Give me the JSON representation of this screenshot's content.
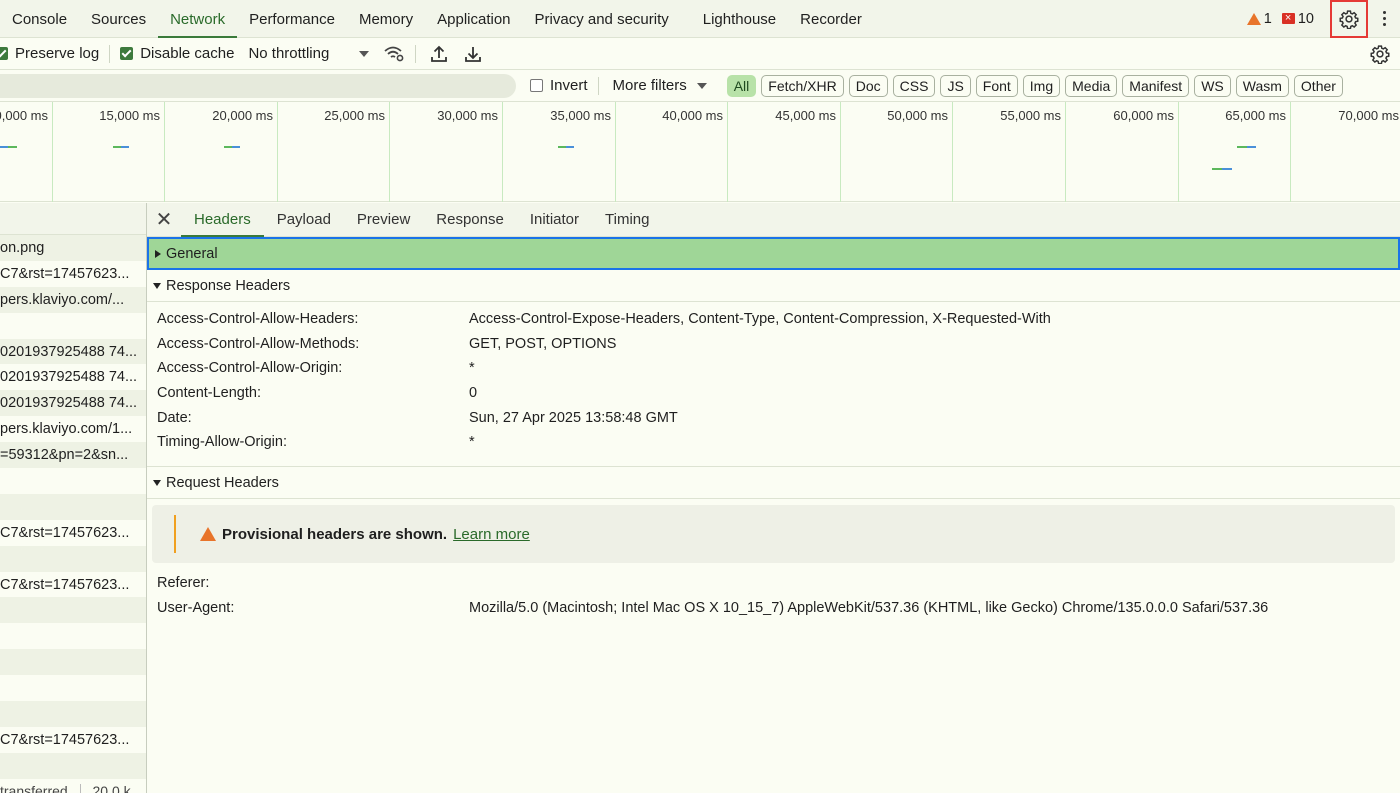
{
  "tabs": [
    {
      "label": "Console",
      "active": false
    },
    {
      "label": "Sources",
      "active": false
    },
    {
      "label": "Network",
      "active": true
    },
    {
      "label": "Performance",
      "active": false
    },
    {
      "label": "Memory",
      "active": false
    },
    {
      "label": "Application",
      "active": false
    },
    {
      "label": "Privacy and security",
      "active": false
    },
    {
      "label": "Lighthouse",
      "active": false
    },
    {
      "label": "Recorder",
      "active": false
    }
  ],
  "status": {
    "warnings": "1",
    "errors": "10"
  },
  "toolbar": {
    "preserve_log": "Preserve log",
    "disable_cache": "Disable cache",
    "throttling": "No throttling"
  },
  "filters": {
    "invert": "Invert",
    "more_filters": "More filters",
    "types": [
      "All",
      "Fetch/XHR",
      "Doc",
      "CSS",
      "JS",
      "Font",
      "Img",
      "Media",
      "Manifest",
      "WS",
      "Wasm",
      "Other"
    ],
    "selected": "All"
  },
  "overview": {
    "labels": [
      "0,000 ms",
      "15,000 ms",
      "20,000 ms",
      "25,000 ms",
      "30,000 ms",
      "35,000 ms",
      "40,000 ms",
      "45,000 ms",
      "50,000 ms",
      "55,000 ms",
      "60,000 ms",
      "65,000 ms",
      "70,000 ms"
    ]
  },
  "requests": [
    "on.png",
    "C7&rst=17457623...",
    "pers.klaviyo.com/...",
    "",
    "0201937925488 74...",
    "0201937925488 74...",
    "0201937925488 74...",
    "pers.klaviyo.com/1...",
    "=59312&pn=2&sn...",
    "",
    "",
    "C7&rst=17457623...",
    "",
    "C7&rst=17457623...",
    "",
    "",
    "",
    "",
    "",
    "C7&rst=17457623...",
    ""
  ],
  "footer": "transferred",
  "footer_size": "20.0 k",
  "details": {
    "tabs": [
      "Headers",
      "Payload",
      "Preview",
      "Response",
      "Initiator",
      "Timing"
    ],
    "active_tab": "Headers",
    "general": "General",
    "response_headers_title": "Response Headers",
    "response_headers": [
      {
        "name": "Access-Control-Allow-Headers:",
        "value": "Access-Control-Expose-Headers, Content-Type, Content-Compression, X-Requested-With"
      },
      {
        "name": "Access-Control-Allow-Methods:",
        "value": "GET, POST, OPTIONS"
      },
      {
        "name": "Access-Control-Allow-Origin:",
        "value": "*"
      },
      {
        "name": "Content-Length:",
        "value": "0"
      },
      {
        "name": "Date:",
        "value": "Sun, 27 Apr 2025 13:58:48 GMT"
      },
      {
        "name": "Timing-Allow-Origin:",
        "value": "*"
      }
    ],
    "request_headers_title": "Request Headers",
    "provisional_text": "Provisional headers are shown.",
    "learn_more": "Learn more",
    "request_headers": [
      {
        "name": "Referer:",
        "value": ""
      },
      {
        "name": "User-Agent:",
        "value": "Mozilla/5.0 (Macintosh; Intel Mac OS X 10_15_7) AppleWebKit/537.36 (KHTML, like Gecko) Chrome/135.0.0.0 Safari/537.36"
      }
    ]
  },
  "colors": {
    "accent": "#3a7a3a",
    "selection": "#9fd697",
    "focus": "#1a73e8",
    "highlight_box": "#e53935"
  }
}
